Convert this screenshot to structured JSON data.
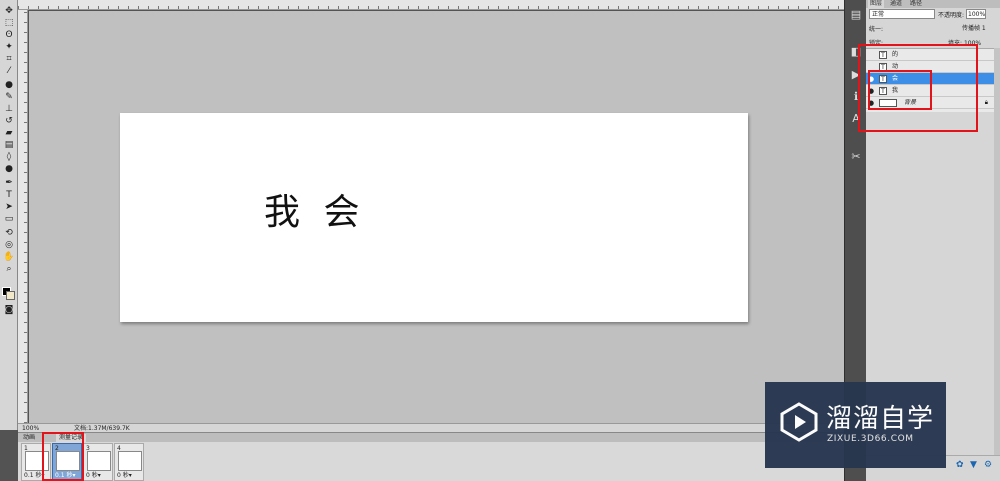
{
  "canvas": {
    "text": "我 会"
  },
  "status": {
    "zoom": "100%",
    "doc_info": "文档:1.37M/639.7K"
  },
  "animation": {
    "tabs": [
      "动画",
      "测量记录"
    ],
    "frames": [
      {
        "number": "1",
        "delay": "0.1 秒▾"
      },
      {
        "number": "2",
        "delay": "0.1 秒▾"
      },
      {
        "number": "3",
        "delay": "0 秒▾"
      },
      {
        "number": "4",
        "delay": "0 秒▾"
      }
    ]
  },
  "layers_panel": {
    "tabs": [
      "图层",
      "通道",
      "路径"
    ],
    "blend_mode": "正常",
    "opacity_label": "不透明度:",
    "opacity_value": "100%",
    "unify_label": "统一:",
    "propagate_label": "传播帧 1",
    "lock_label": "锁定:",
    "fill_label": "填充:",
    "fill_value": "100%",
    "layers": [
      {
        "name": "的",
        "visible": false,
        "selected": false,
        "type": "T"
      },
      {
        "name": "动",
        "visible": false,
        "selected": false,
        "type": "T"
      },
      {
        "name": "会",
        "visible": true,
        "selected": true,
        "type": "T"
      },
      {
        "name": "我",
        "visible": true,
        "selected": false,
        "type": "T"
      },
      {
        "name": "背景",
        "visible": true,
        "selected": false,
        "type": "bg"
      }
    ]
  },
  "watermark": {
    "title": "溜溜自学",
    "url": "ZIXUE.3D66.COM"
  },
  "colors": {
    "annotation": "#e0141a",
    "selected_layer": "#3d8ee6"
  }
}
